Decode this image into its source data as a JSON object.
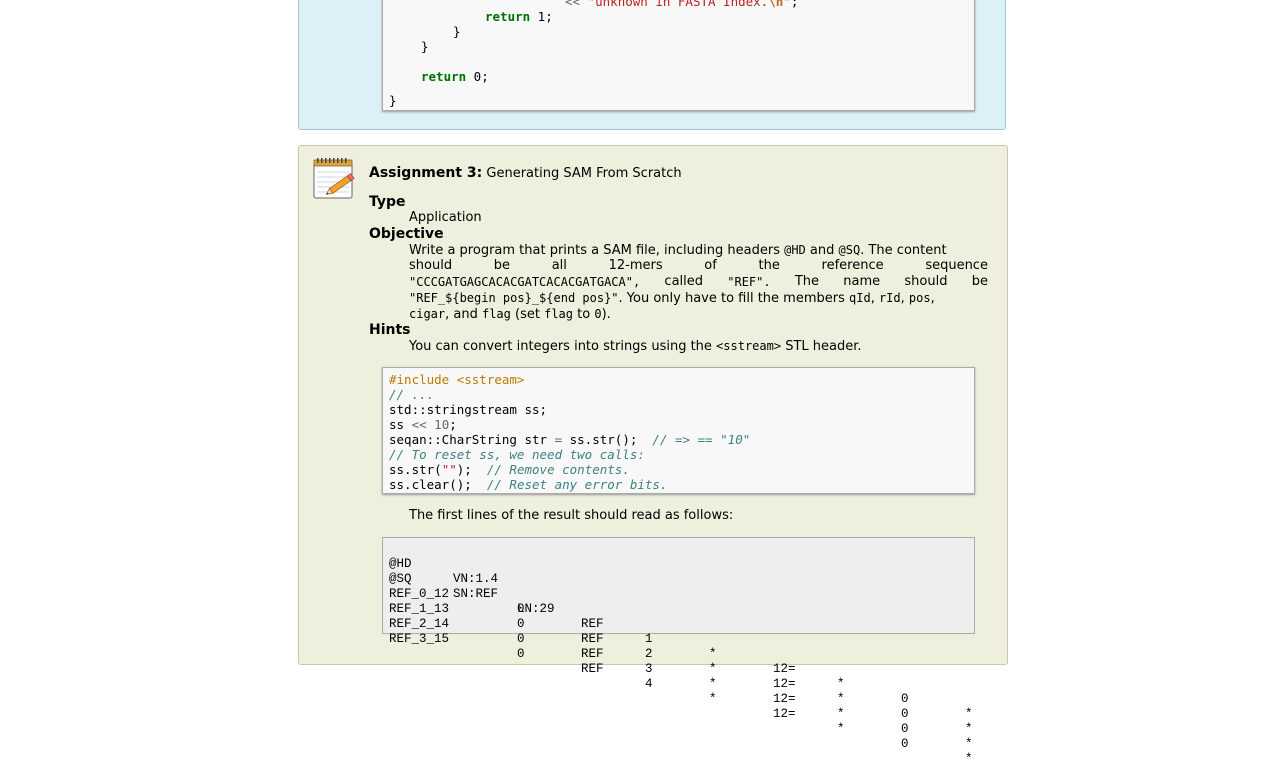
{
  "solution": {
    "line1_op": "<<",
    "line1_str_a": "\"unknown in FASTA Index.",
    "line1_esc": "\\n",
    "line1_str_b": "\"",
    "line1_end": ";",
    "line2_kw": "return",
    "line2_rest": " 1;",
    "line3": "}",
    "line4": "}",
    "line5_kw": "return",
    "line5_rest": " 0;",
    "closing": "}"
  },
  "assignment": {
    "label": "Assignment 3:",
    "title": "Generating SAM From Scratch",
    "type_heading": "Type",
    "type_value": "Application",
    "objective_heading": "Objective",
    "objective": {
      "l1_a": "Write a program that prints a SAM file, including headers ",
      "l1_hd": "@HD",
      "l1_b": " and ",
      "l1_sq": "@SQ",
      "l1_c": ". The content",
      "l2_words": [
        "should",
        "be",
        "all",
        "12-mers",
        "of",
        "the",
        "reference",
        "sequence"
      ],
      "l3_seq": "\"CCCGATGAGCACACGATCACACGATGACA\",",
      "l3_called": "called",
      "l3_ref": "\"REF\".",
      "l3_words": [
        "The",
        "name",
        "should",
        "be"
      ],
      "l4_fmt": "\"REF_${begin pos}_${end pos}\"",
      "l4_a": ". You only have to fill the members ",
      "l4_qid": "qId",
      "l4_rid": "rId",
      "l4_pos": "pos",
      "l4_sep": ", ",
      "l5_cigar": "cigar",
      "l5_a": ", and ",
      "l5_flag": "flag",
      "l5_b": " (set ",
      "l5_flag2": "flag",
      "l5_c": " to ",
      "l5_zero": "0",
      "l5_d": ")."
    },
    "hints_heading": "Hints",
    "hints_text_a": "You can convert integers into strings using the ",
    "hints_text_code": "<sstream>",
    "hints_text_b": " STL header.",
    "hint_code": {
      "l1": "#include <sstream>",
      "l2": "// ...",
      "l3": "std::stringstream ss;",
      "l4_a": "ss ",
      "l4_op": "<<",
      "l4_num": " 10",
      "l4_end": ";",
      "l5_a": "seqan::CharString str ",
      "l5_op": "=",
      "l5_b": " ss.str();  ",
      "l5_cm": "// => == \"10\"",
      "l6": "// To reset ss, we need two calls:",
      "l7_a": "ss.str(",
      "l7_str": "\"\"",
      "l7_b": ");  ",
      "l7_cm": "// Remove contents.",
      "l8_a": "ss.clear();  ",
      "l8_cm": "// Reset any error bits."
    },
    "result_intro": "The first lines of the result should read as follows:",
    "sam_header": [
      [
        "@HD",
        "VN:1.4",
        ""
      ],
      [
        "@SQ",
        "SN:REF",
        "LN:29"
      ]
    ],
    "sam_rows": [
      [
        "REF_0_12",
        "0",
        "REF",
        "1",
        "*",
        "12=",
        "*",
        "0",
        "*"
      ],
      [
        "REF_1_13",
        "0",
        "REF",
        "2",
        "*",
        "12=",
        "*",
        "0",
        "*"
      ],
      [
        "REF_2_14",
        "0",
        "REF",
        "3",
        "*",
        "12=",
        "*",
        "0",
        "*"
      ],
      [
        "REF_3_15",
        "0",
        "REF",
        "4",
        "*",
        "12=",
        "*",
        "0",
        "*"
      ]
    ]
  }
}
